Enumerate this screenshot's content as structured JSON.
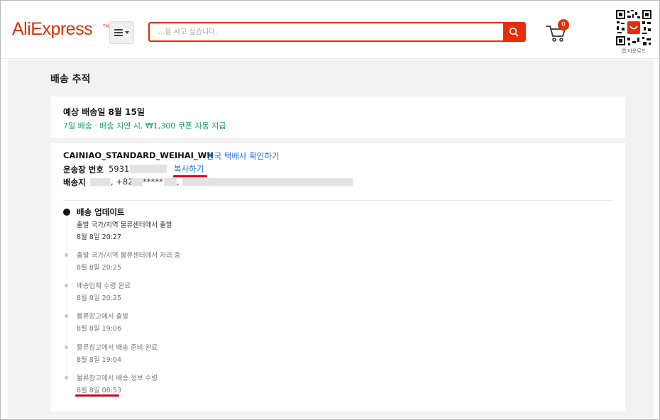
{
  "header": {
    "logo_text": "AliExpress",
    "logo_tm": "TM",
    "search_placeholder": "...을 사고 싶습니다.",
    "cart_count": "0",
    "qr_label": "앱 다운로드",
    "brand_color": "#e62e04"
  },
  "page": {
    "title": "배송 추적"
  },
  "eta": {
    "title": "예상 배송일 8월 15일",
    "note": "7일 배송 · 배송 지연 시, ₩1,300 쿠폰 자동 지급"
  },
  "shipment": {
    "carrier": "CAINIAO_STANDARD_WEIHAI_WH",
    "carrier_link": "한국 택배사 확인하기",
    "tracking_label": "운송장 번호",
    "tracking_value": "5931",
    "copy_link": "복사하기",
    "address_label": "배송지",
    "address_phone": ", +82",
    "address_phone_mask": "*****"
  },
  "timeline": {
    "heading": "배송 업데이트",
    "events": [
      {
        "desc": "출발 국가/지역 물류센터에서 출발",
        "time": "8월 8일 20:27"
      },
      {
        "desc": "출발 국가/지역 물류센터에서 처리 중",
        "time": "8월 8일 20:25"
      },
      {
        "desc": "배송업체 수령 완료",
        "time": "8월 8일 20:25"
      },
      {
        "desc": "물류창고에서 출발",
        "time": "8월 8일 19:06"
      },
      {
        "desc": "물류창고에서 배송 준비 완료",
        "time": "8월 8일 19:04"
      },
      {
        "desc": "물류창고에서 배송 정보 수령",
        "time": "8월 8일 08:53"
      }
    ]
  }
}
